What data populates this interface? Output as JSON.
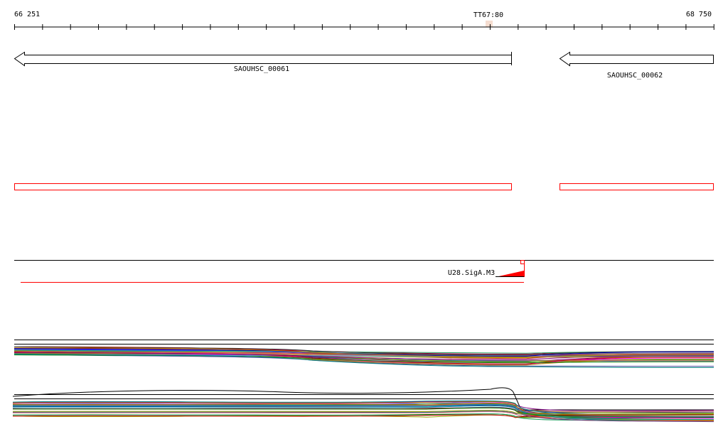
{
  "ruler": {
    "start_label": "66 251",
    "end_label": "68 750",
    "marker_label": "TT67:80"
  },
  "genes": [
    {
      "name": "SAOUHSC_00061",
      "strand": "-"
    },
    {
      "name": "SAOUHSC_00062",
      "strand": "-"
    }
  ],
  "feature": {
    "name": "U28.SigA.M3",
    "color": "#ff0000"
  },
  "colors": {
    "cds_outline": "#ff0000",
    "ink": "#000000",
    "marker_highlight": "#f5ddd0"
  }
}
